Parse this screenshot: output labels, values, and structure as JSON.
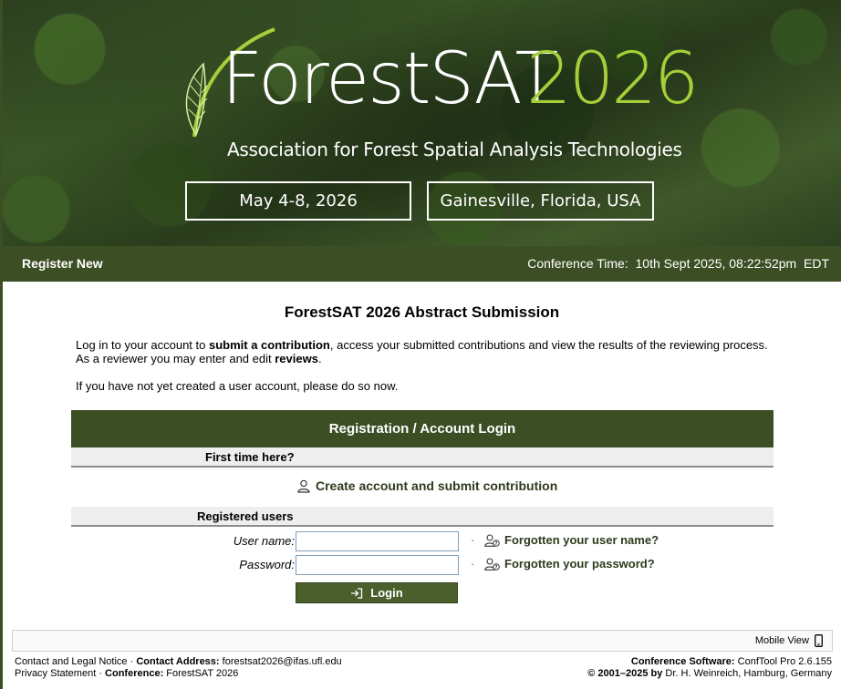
{
  "banner": {
    "logo_forest": "ForestSAT",
    "logo_year": "2026",
    "subtitle": "Association for Forest Spatial Analysis Technologies",
    "date": "May 4-8, 2026",
    "location": "Gainesville, Florida, USA"
  },
  "nav": {
    "register_new": "Register New",
    "time_label": "Conference Time:",
    "time_value": "10th Sept 2025, 08:22:52pm",
    "time_zone": "EDT"
  },
  "main": {
    "title": "ForestSAT 2026 Abstract Submission",
    "intro": {
      "p1_a": "Log in to your account to ",
      "p1_b": "submit a contribution",
      "p1_c": ", access your submitted contributions and view the results of the reviewing process. As a reviewer you may enter and edit ",
      "p1_d": "reviews",
      "p1_e": ".",
      "p2": "If you have not yet created a user account, please do so now."
    },
    "panel": {
      "title": "Registration / Account Login",
      "first_time": "First time here?",
      "create_link": "Create account and submit contribution",
      "registered": "Registered users",
      "username_label": "User name:",
      "username_value": "",
      "password_label": "Password:",
      "password_value": "",
      "separator": "·",
      "forgot_username": "Forgotten your user name?",
      "forgot_password": "Forgotten your password?",
      "login_label": "Login"
    }
  },
  "footer": {
    "mobile_view": "Mobile View",
    "contact_legal": "Contact and Legal Notice",
    "sep": " · ",
    "contact_address_label": "Contact Address:",
    "contact_address": "forestsat2026@ifas.ufl.edu",
    "privacy": "Privacy Statement",
    "conference_label": "Conference:",
    "conference_name": "ForestSAT 2026",
    "software_label": "Conference Software:",
    "software_name": "ConfTool Pro",
    "software_version": "2.6.155",
    "copyright_a": "© 2001–2025 by",
    "copyright_b": "Dr. H. Weinreich, Hamburg, Germany"
  },
  "colors": {
    "brand_green": "#3c4f24",
    "logo_lime": "#a5cf3a"
  },
  "icons": [
    "leaf-icon",
    "user-icon",
    "user-question-icon",
    "login-icon",
    "mobile-icon"
  ]
}
